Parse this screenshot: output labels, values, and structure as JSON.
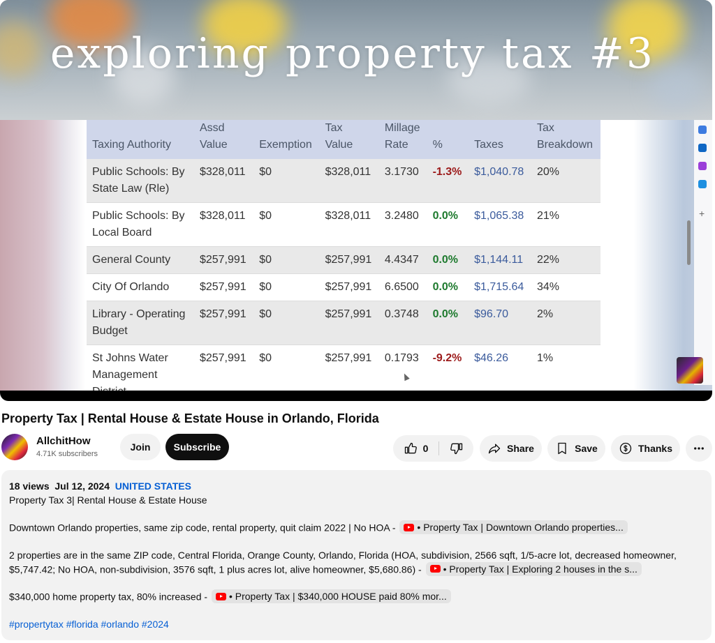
{
  "video": {
    "banner_title": "exploring property tax #3",
    "table": {
      "headers": [
        [
          "Taxing Authority"
        ],
        [
          "Assd",
          "Value"
        ],
        [
          "Exemption"
        ],
        [
          "Tax",
          "Value"
        ],
        [
          "Millage",
          "Rate"
        ],
        [
          "%"
        ],
        [
          "Taxes"
        ],
        [
          "Tax",
          "Breakdown"
        ]
      ],
      "rows": [
        {
          "authority": [
            "Public Schools: By",
            "State Law (Rle)"
          ],
          "assd": "$328,011",
          "exemption": "$0",
          "tax_value": "$328,011",
          "millage": "3.1730",
          "pct": "-1.3%",
          "pct_kind": "neg",
          "taxes": "$1,040.78",
          "breakdown": "20%"
        },
        {
          "authority": [
            "Public Schools: By",
            "Local Board"
          ],
          "assd": "$328,011",
          "exemption": "$0",
          "tax_value": "$328,011",
          "millage": "3.2480",
          "pct": "0.0%",
          "pct_kind": "zero",
          "taxes": "$1,065.38",
          "breakdown": "21%"
        },
        {
          "authority": [
            "General County"
          ],
          "assd": "$257,991",
          "exemption": "$0",
          "tax_value": "$257,991",
          "millage": "4.4347",
          "pct": "0.0%",
          "pct_kind": "zero",
          "taxes": "$1,144.11",
          "breakdown": "22%"
        },
        {
          "authority": [
            "City Of Orlando"
          ],
          "assd": "$257,991",
          "exemption": "$0",
          "tax_value": "$257,991",
          "millage": "6.6500",
          "pct": "0.0%",
          "pct_kind": "zero",
          "taxes": "$1,715.64",
          "breakdown": "34%"
        },
        {
          "authority": [
            "Library - Operating",
            "Budget"
          ],
          "assd": "$257,991",
          "exemption": "$0",
          "tax_value": "$257,991",
          "millage": "0.3748",
          "pct": "0.0%",
          "pct_kind": "zero",
          "taxes": "$96.70",
          "breakdown": "2%"
        },
        {
          "authority": [
            "St Johns Water",
            "Management",
            "District"
          ],
          "assd": "$257,991",
          "exemption": "$0",
          "tax_value": "$257,991",
          "millage": "0.1793",
          "pct": "-9.2%",
          "pct_kind": "neg",
          "taxes": "$46.26",
          "breakdown": "1%"
        }
      ]
    }
  },
  "title": "Property Tax | Rental House & Estate House in Orlando, Florida",
  "channel": {
    "name": "AllchitHow",
    "subscribers": "4.71K subscribers",
    "join_label": "Join",
    "subscribe_label": "Subscribe"
  },
  "actions": {
    "like_count": "0",
    "share_label": "Share",
    "save_label": "Save",
    "thanks_label": "Thanks"
  },
  "description": {
    "views": "18 views",
    "date": "Jul 12, 2024",
    "location": "UNITED STATES",
    "line1": "Property Tax 3| Rental House & Estate House",
    "para2_text": "Downtown Orlando properties, same zip code, rental property, quit claim 2022 | No HOA -",
    "para2_chip": "• Property Tax | Downtown Orlando properties...",
    "para3_text": "2 properties are in the same ZIP code, Central Florida, Orange County, Orlando, Florida (HOA, subdivision, 2566 sqft, 1/5-acre lot, decreased homeowner, $5,747.42; No HOA, non-subdivision, 3576 sqft, 1 plus acres lot, alive homeowner, $5,680.86) -",
    "para3_chip": "• Property Tax | Exploring 2 houses in the s...",
    "para4_text": "$340,000 home property tax, 80% increased -",
    "para4_chip": "• Property Tax | $340,000 HOUSE paid 80% mor...",
    "hashtags": "#propertytax #florida #orlando #2024"
  },
  "colors": {
    "negative": "#9c1b1b",
    "zero": "#1e7a2e",
    "link": "#065fd4",
    "tax_amount": "#3b5b9c"
  }
}
